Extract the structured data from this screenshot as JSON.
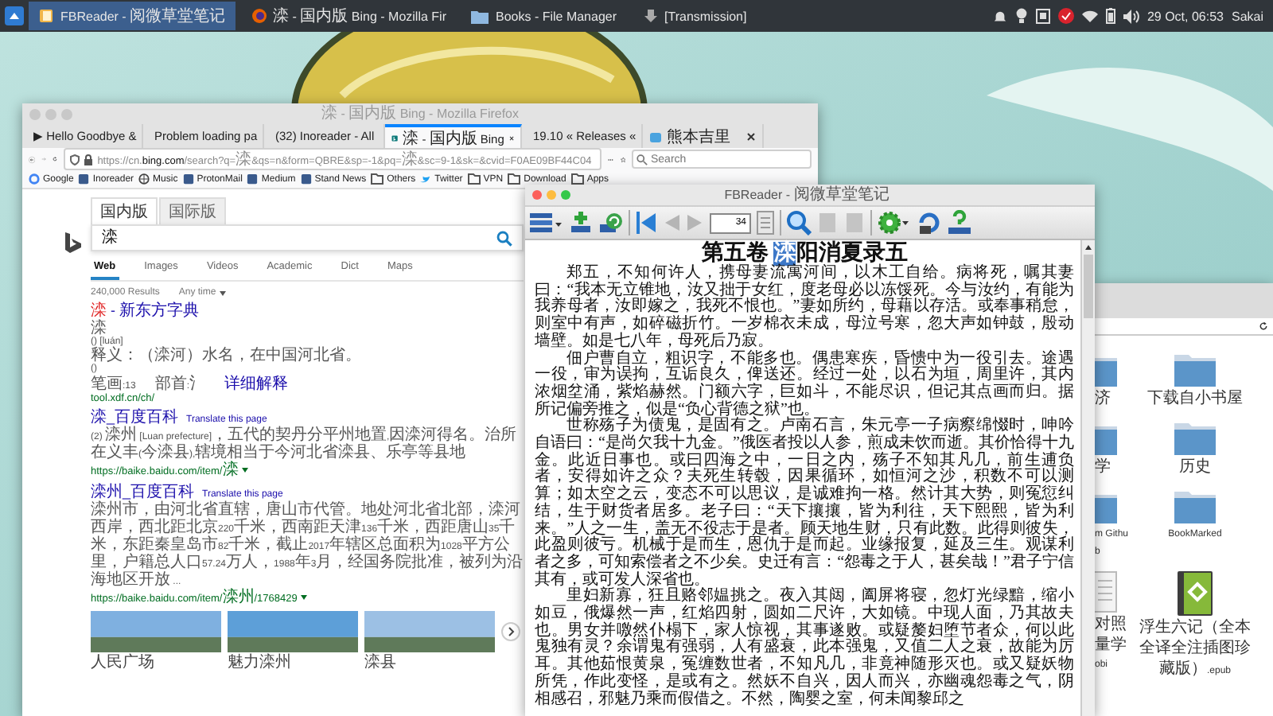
{
  "top_panel": {
    "tasks": [
      {
        "kind": "reader",
        "label": "FBReader - 阅微草堂笔记",
        "selected": true
      },
      {
        "kind": "browser",
        "label": "滦 - 国内版 Bing - Mozilla Fir",
        "selected": false
      },
      {
        "kind": "folder",
        "label": "Books - File Manager",
        "selected": false
      },
      {
        "kind": "torrent",
        "label": "[Transmission]",
        "selected": false
      }
    ],
    "clock": "29 Oct, 06:53",
    "user": "Sakai"
  },
  "browser": {
    "title": "滦 - 国内版 Bing - Mozilla Firefox",
    "tabs": [
      {
        "kind": "video",
        "label": "▶ Hello Goodbye &",
        "selected": false
      },
      {
        "kind": "warning",
        "label": "Problem loading pa",
        "selected": false
      },
      {
        "kind": "feed",
        "label": "(32) Inoreader - All",
        "selected": false
      },
      {
        "kind": "bing",
        "label": "滦 - 国内版 Bing",
        "selected": true
      },
      {
        "kind": "release",
        "label": "19.10 « Releases «",
        "selected": false
      },
      {
        "kind": "cat",
        "label": "熊本吉里",
        "selected": false
      }
    ],
    "url": {
      "host_before": "https://cn.",
      "host": "bing.com",
      "rest": "/search?q=滦&qs=n&form=QBRE&sp=-1&pq=滦&sc=9-1&sk=&cvid=F0AE09BF44C04"
    },
    "search": {
      "placeholder": "Search"
    },
    "bookmarks": [
      {
        "kind": "google",
        "label": "Google"
      },
      {
        "kind": "site",
        "label": "Inoreader"
      },
      {
        "kind": "globe",
        "label": "Music"
      },
      {
        "kind": "site",
        "label": "ProtonMail"
      },
      {
        "kind": "site",
        "label": "Medium"
      },
      {
        "kind": "site",
        "label": "Stand News"
      },
      {
        "kind": "folder",
        "label": "Others"
      },
      {
        "kind": "bird",
        "label": "Twitter"
      },
      {
        "kind": "folder",
        "label": "VPN"
      },
      {
        "kind": "folder",
        "label": "Download"
      },
      {
        "kind": "folder",
        "label": "Apps"
      }
    ],
    "page": {
      "scopes": [
        {
          "label": "国内版",
          "selected": true
        },
        {
          "label": "国际版",
          "selected": false
        }
      ],
      "query": "滦",
      "verticals": [
        {
          "label": "Web",
          "selected": true
        },
        {
          "label": "Images",
          "selected": false
        },
        {
          "label": "Videos",
          "selected": false
        },
        {
          "label": "Academic",
          "selected": false
        },
        {
          "label": "Dict",
          "selected": false
        },
        {
          "label": "Maps",
          "selected": false
        }
      ],
      "result_count": "240,000 Results",
      "time_filter": "Any time",
      "results": [
        {
          "kind": "dictionary",
          "title": [
            {
              "text": "滦",
              "highlight": true
            },
            {
              "text": " - 新东方字典",
              "highlight": false
            }
          ],
          "lines": [
            "滦",
            "() [luán]",
            "释义：（滦河）水名，在中国河北省。",
            "()"
          ],
          "meta": [
            "笔画:13",
            "部首:氵"
          ],
          "detail_link": "详细解释",
          "url": "tool.xdf.cn/ch/"
        },
        {
          "kind": "article",
          "title": [
            {
              "text": "滦_百度百科",
              "highlight": false
            }
          ],
          "translate": "Translate this page",
          "snippet": "(2) 滦州 [Luan prefecture]，五代的契丹分平州地置,因滦河得名。治所在义丰(今滦县),辖境相当于今河北省滦县、乐亭等县地",
          "url": "https://baike.baidu.com/item/滦"
        },
        {
          "kind": "article",
          "title": [
            {
              "text": "滦州_百度百科",
              "highlight": false
            }
          ],
          "translate": "Translate this page",
          "snippet": "滦州市，由河北省直辖，唐山市代管。地处河北省北部，滦河西岸，西北距北京220千米，西南距天津136千米，西距唐山35千米，东距秦皇岛市82千米，截止2017年辖区总面积为1028平方公里，户籍总人口57.24万人，1988年3月，经国务院批准，被列为沿海地区开放 ...",
          "url": "https://baike.baidu.com/item/滦州/1768429"
        }
      ],
      "images": [
        {
          "caption": "人民广场"
        },
        {
          "caption": "魅力滦州"
        },
        {
          "caption": "滦县"
        }
      ]
    }
  },
  "reader": {
    "title": "FBReader - 阅微草堂笔记",
    "page_field": "34",
    "heading": {
      "before": "第五卷 ",
      "selection": "滦",
      "after": "阳消夏录五"
    },
    "paragraphs": [
      "郑五，不知何许人，携母妻流寓河间，以木工自给。病将死，嘱其妻曰：“我本无立锥地，汝又拙于女红，度老母必以冻馁死。今与汝约，有能为我养母者，汝即嫁之，我死不恨也。”妻如所约，母藉以存活。或奉事稍怠，则室中有声，如碎磁折竹。一岁棉衣未成，母泣号寒，忽大声如钟鼓，殷动墙壁。如是七八年，母死后乃寂。",
      "佃户曹自立，粗识字，不能多也。偶患寒疾，昏愦中为一役引去。途遇一役，审为误拘，互诟良久，俾送还。经过一处，以石为垣，周里许，其内浓烟坌涌，紫焰赫然。门额六字，巨如斗，不能尽识，但记其点画而归。据所记偏旁推之，似是“负心背德之狱”也。",
      "世称殇子为债鬼，是固有之。卢南石言，朱元亭一子病瘵绵惙时，呻吟自语曰：“是尚欠我十九金。”俄医者投以人参，煎成未饮而逝。其价恰得十九金。此近日事也。或曰四海之中，一日之内，殇子不知其凡几，前生逋负者，安得如许之众？夫死生转毂，因果循环，如恒河之沙，积数不可以测算；如太空之云，变态不可以思议，是诚难拘一格。然计其大势，则冤愆纠结，生于财货者居多。老子曰：“天下攘攘，皆为利往，天下熙熙，皆为利来。”人之一生，盖无不役志于是者。顾天地生财，只有此数。此得则彼失，此盈则彼亏。机械于是而生，恩仇于是而起。业缘报复，延及三生。观谋利者之多，可知索偿者之不少矣。史迁有言：“怨毒之于人，甚矣哉！”君子宁信其有，或可发人深省也。",
      "里妇新寡，狂且赂邻媪挑之。夜入其闼，阖屏将寝，忽灯光绿黯，缩小如豆，俄爆然一声，红焰四射，圆如二尺许，大如镜。中现人面，乃其故夫也。男女并噭然仆榻下，家人惊视，其事遂败。或疑嫠妇堕节者众，何以此鬼独有灵？余谓鬼有强弱，人有盛衰，此本强鬼，又值二人之衰，故能为厉耳。其他茹恨黄泉，冤缠数世者，不知凡几，非竟神随形灭也。或又疑妖物所凭，作此变怪，是或有之。然妖不自兴，因人而兴，亦幽魂怨毒之气，阴相感召，邪魅乃乘而假借之。不然，陶婴之室，何未闻黎邱之"
    ]
  },
  "file_manager": {
    "items": [
      {
        "kind": "folder",
        "label": "济"
      },
      {
        "kind": "folder",
        "label": "下载自小书屋"
      },
      {
        "kind": "folder",
        "label": "学"
      },
      {
        "kind": "folder",
        "label": "历史"
      },
      {
        "kind": "folder",
        "label": "m Github"
      },
      {
        "kind": "folder",
        "label": "BookMarked"
      },
      {
        "kind": "document",
        "label": "对照量学 obi"
      },
      {
        "kind": "ebook",
        "label": "浮生六记（全本全译全注插图珍藏版）.epub"
      }
    ]
  }
}
